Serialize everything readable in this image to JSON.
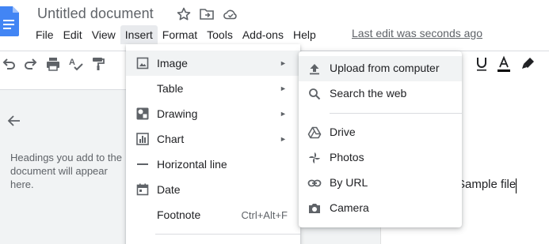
{
  "app": {
    "document_title": "Untitled document",
    "last_edit": "Last edit was seconds ago"
  },
  "menubar": {
    "items": [
      "File",
      "Edit",
      "View",
      "Insert",
      "Format",
      "Tools",
      "Add-ons",
      "Help"
    ],
    "active": "Insert"
  },
  "outline": {
    "hint": "Headings you add to the document will appear here."
  },
  "document": {
    "text": "Sample file"
  },
  "insert_menu": {
    "items": [
      {
        "label": "Image",
        "icon": "image-icon",
        "submenu": true
      },
      {
        "label": "Table",
        "icon": "",
        "submenu": true
      },
      {
        "label": "Drawing",
        "icon": "drawing-icon",
        "submenu": true
      },
      {
        "label": "Chart",
        "icon": "chart-icon",
        "submenu": true
      },
      {
        "label": "Horizontal line",
        "icon": "horizontal-line-icon",
        "submenu": false
      },
      {
        "label": "Date",
        "icon": "calendar-icon",
        "submenu": false
      },
      {
        "label": "Footnote",
        "icon": "",
        "submenu": false,
        "shortcut": "Ctrl+Alt+F"
      }
    ],
    "highlighted": "Image",
    "arrow_glyph": "►"
  },
  "image_submenu": {
    "items": [
      {
        "label": "Upload from computer",
        "icon": "upload-icon"
      },
      {
        "label": "Search the web",
        "icon": "search-icon"
      },
      {
        "label": "Drive",
        "icon": "drive-icon"
      },
      {
        "label": "Photos",
        "icon": "photos-icon"
      },
      {
        "label": "By URL",
        "icon": "link-icon"
      },
      {
        "label": "Camera",
        "icon": "camera-icon"
      }
    ],
    "highlighted": "Upload from computer"
  },
  "toolbar": {
    "icons": [
      "undo-icon",
      "redo-icon",
      "print-icon",
      "spellcheck-icon",
      "paint-format-icon",
      "underline-icon",
      "text-color-icon",
      "highlight-icon"
    ]
  },
  "colors": {
    "docs_blue": "#4285f4",
    "menu_highlight": "#f1f3f4",
    "icon_gray": "#5f6368"
  }
}
